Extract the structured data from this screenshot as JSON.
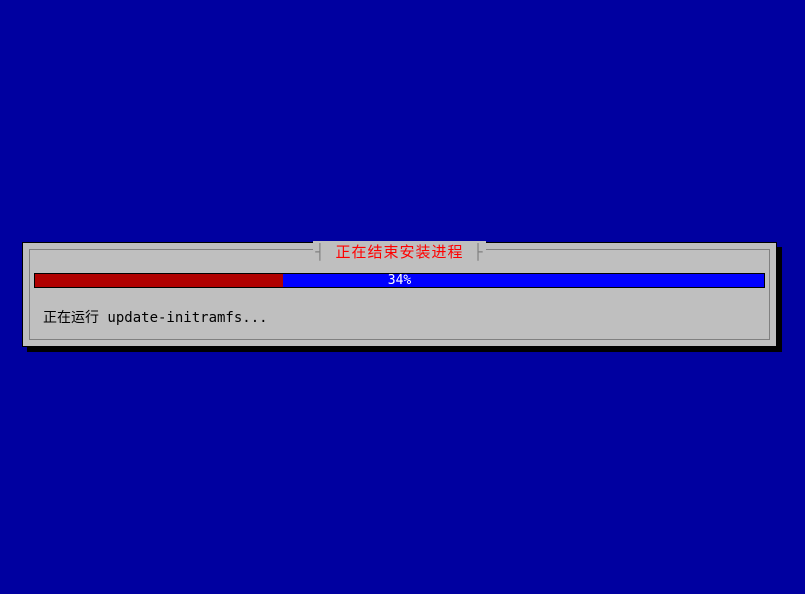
{
  "dialog": {
    "title": "正在结束安装进程",
    "progress_percent": 34,
    "progress_text": "34%",
    "status_text": "正在运行 update-initramfs..."
  }
}
